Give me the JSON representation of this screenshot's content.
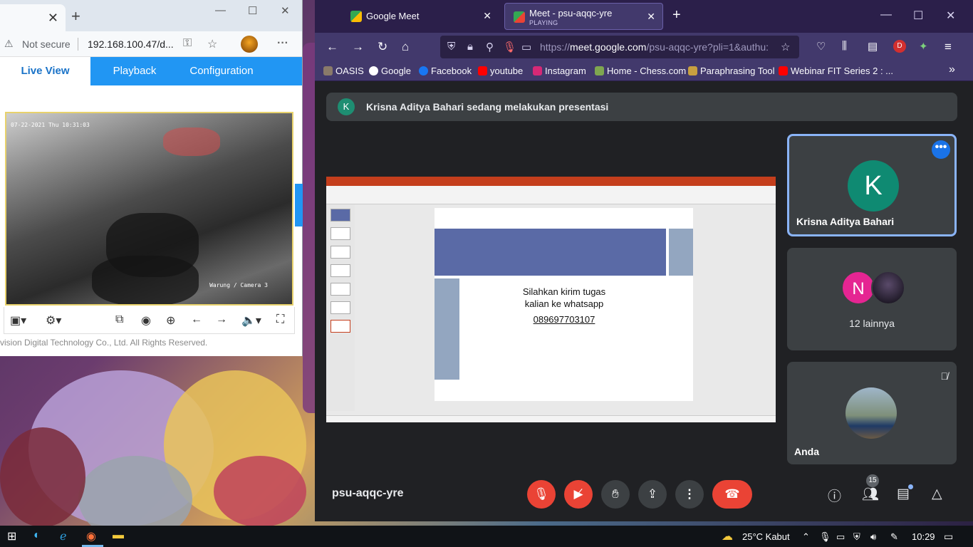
{
  "camera_window": {
    "security": "Not secure",
    "url": "192.168.100.47/d...",
    "nav": [
      "Live View",
      "Playback",
      "Configuration"
    ],
    "timestamp": "07-22-2021 Thu 10:31:03",
    "camera_label": "Warung / Camera 3",
    "copyright": "vision Digital Technology Co., Ltd. All Rights Reserved."
  },
  "firefox": {
    "tabs": [
      {
        "title": "Google Meet",
        "sub": ""
      },
      {
        "title": "Meet - psu-aqqc-yre",
        "sub": "PLAYING"
      }
    ],
    "url_prefix": "https://",
    "url_domain": "meet.google.com",
    "url_rest": "/psu-aqqc-yre?pli=1&authu:",
    "bookmarks": [
      "OASIS",
      "Google",
      "Facebook",
      "youtube",
      "Instagram",
      "Home - Chess.com",
      "Paraphrasing Tool",
      "Webinar FIT Series 2 : ..."
    ],
    "profile_initial": "D"
  },
  "meet": {
    "banner_initial": "K",
    "banner_text": "Krisna Aditya Bahari sedang melakukan presentasi",
    "slide": {
      "line1": "Silahkan kirim tugas",
      "line2": "kalian ke whatsapp",
      "line3": "089697703107"
    },
    "participants": {
      "presenter_initial": "K",
      "presenter_name": "Krisna Aditya Bahari",
      "group_initial": "N",
      "group_label": "12 lainnya",
      "self_name": "Anda"
    },
    "meeting_code": "psu-aqqc-yre",
    "people_count": "15"
  },
  "taskbar": {
    "weather": "25°C  Kabut",
    "time": "10:29"
  }
}
